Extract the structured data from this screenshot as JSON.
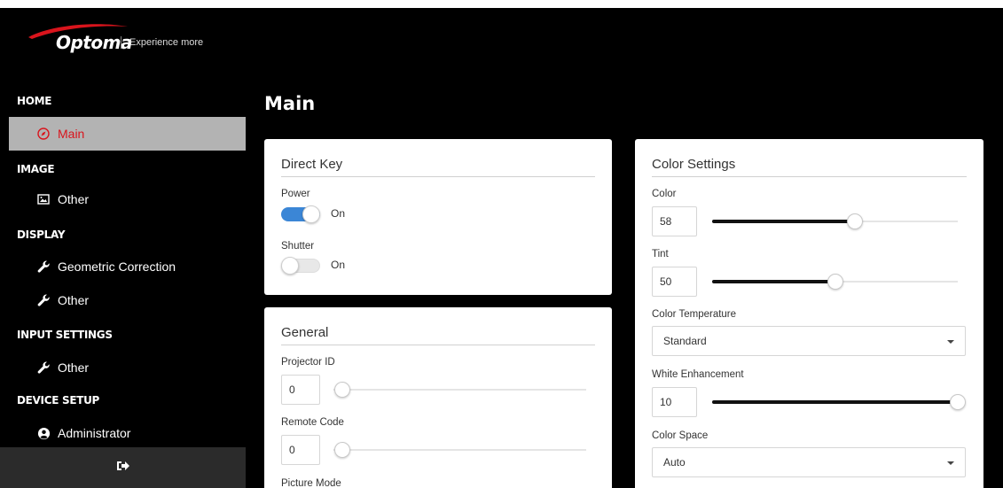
{
  "header": {
    "brand": "Optoma",
    "tagline": "Experience more"
  },
  "sidebar": {
    "sections": [
      {
        "title": "HOME",
        "items": [
          {
            "label": "Main",
            "icon": "compass-icon",
            "active": true
          }
        ]
      },
      {
        "title": "IMAGE",
        "items": [
          {
            "label": "Other",
            "icon": "image-icon"
          }
        ]
      },
      {
        "title": "DISPLAY",
        "items": [
          {
            "label": "Geometric Correction",
            "icon": "wrench-icon"
          },
          {
            "label": "Other",
            "icon": "wrench-icon"
          }
        ]
      },
      {
        "title": "INPUT SETTINGS",
        "items": [
          {
            "label": "Other",
            "icon": "wrench-icon"
          }
        ]
      },
      {
        "title": "DEVICE SETUP",
        "items": [
          {
            "label": "Administrator",
            "icon": "user-circle-icon"
          }
        ]
      }
    ],
    "logout_icon": "sign-out-icon"
  },
  "main": {
    "title": "Main",
    "direct_key": {
      "title": "Direct Key",
      "power": {
        "label": "Power",
        "state": "On",
        "enabled": true
      },
      "shutter": {
        "label": "Shutter",
        "state": "On",
        "enabled": false
      }
    },
    "general": {
      "title": "General",
      "projector_id": {
        "label": "Projector ID",
        "value": "0",
        "min": 0,
        "max": 99
      },
      "remote_code": {
        "label": "Remote Code",
        "value": "0",
        "min": 0,
        "max": 99
      },
      "picture_mode": {
        "label": "Picture Mode"
      }
    },
    "color_settings": {
      "title": "Color Settings",
      "color": {
        "label": "Color",
        "value": "58",
        "fraction": 0.58
      },
      "tint": {
        "label": "Tint",
        "value": "50",
        "fraction": 0.5
      },
      "color_temperature": {
        "label": "Color Temperature",
        "value": "Standard"
      },
      "white_enhancement": {
        "label": "White Enhancement",
        "value": "10",
        "fraction": 1.0
      },
      "color_space": {
        "label": "Color Space",
        "value": "Auto"
      }
    }
  },
  "colors": {
    "accent": "#3b86d6",
    "active_text": "#d9141c",
    "active_bg": "#b3b3b3",
    "background": "#000000"
  }
}
